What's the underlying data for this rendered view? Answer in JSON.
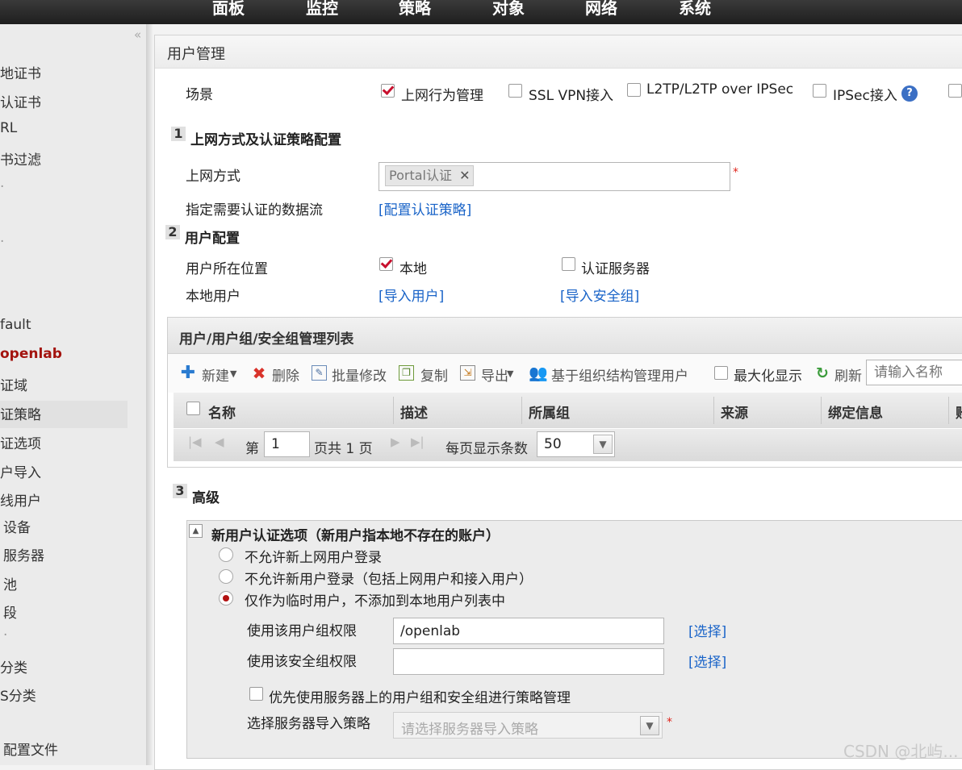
{
  "nav": [
    "面板",
    "监控",
    "策略",
    "对象",
    "网络",
    "系统"
  ],
  "sidebar": {
    "collapse": "«",
    "items": [
      "地证书",
      "认证书",
      "RL",
      "书过滤",
      "·",
      "·",
      "fault",
      "openlab",
      "证域",
      "证策略",
      "证选项",
      "户导入",
      "线用户",
      "设备",
      "服务器",
      "池",
      "段",
      "·",
      "分类",
      "S分类",
      "配置文件"
    ],
    "active_label": "openlab"
  },
  "panel_title": "用户管理",
  "scene": {
    "label": "场景",
    "options": [
      {
        "label": "上网行为管理",
        "checked": true
      },
      {
        "label": "SSL VPN接入",
        "checked": false
      },
      {
        "label": "L2TP/L2TP over IPSec",
        "checked": false
      },
      {
        "label": "IPSec接入",
        "checked": false
      }
    ],
    "help": "?"
  },
  "s1": {
    "num": "1",
    "title": "上网方式及认证策略配置",
    "access_label": "上网方式",
    "access_tag": "Portal认证",
    "tag_close": "✕",
    "required": "*",
    "flow_label": "指定需要认证的数据流",
    "flow_link": "[配置认证策略]"
  },
  "s2": {
    "num": "2",
    "title": "用户配置",
    "loc_label": "用户所在位置",
    "loc_local": {
      "label": "本地",
      "checked": true
    },
    "loc_server": {
      "label": "认证服务器",
      "checked": false
    },
    "local_label": "本地用户",
    "import_users": "[导入用户]",
    "import_groups": "[导入安全组]"
  },
  "list": {
    "title": "用户/用户组/安全组管理列表",
    "toolbar": {
      "new": "新建",
      "delete": "删除",
      "batch": "批量修改",
      "copy": "复制",
      "export": "导出",
      "org": "基于组织结构管理用户",
      "maximize": "最大化显示",
      "refresh": "刷新",
      "search_placeholder": "请输入名称"
    },
    "columns": [
      "名称",
      "描述",
      "所属组",
      "来源",
      "绑定信息",
      "账"
    ],
    "pager": {
      "prefix": "第",
      "page": "1",
      "suffix": "页共 1 页",
      "per_page_label": "每页显示条数",
      "per_page": "50"
    }
  },
  "s3": {
    "num": "3",
    "title": "高级",
    "box_title": "新用户认证选项（新用户指本地不存在的账户）",
    "toggle": "▲",
    "options": [
      {
        "label": "不允许新上网用户登录",
        "checked": false
      },
      {
        "label": "不允许新用户登录（包括上网用户和接入用户）",
        "checked": false
      },
      {
        "label": "仅作为临时用户，不添加到本地用户列表中",
        "checked": true
      }
    ],
    "group_label": "使用该用户组权限",
    "group_value": "/openlab",
    "group_select": "[选择]",
    "sec_label": "使用该安全组权限",
    "sec_value": "",
    "sec_select": "[选择]",
    "prefer_label": "优先使用服务器上的用户组和安全组进行策略管理",
    "server_policy_label": "选择服务器导入策略",
    "server_policy_placeholder": "请选择服务器导入策略",
    "required": "*"
  },
  "watermark": "CSDN @北屿..."
}
